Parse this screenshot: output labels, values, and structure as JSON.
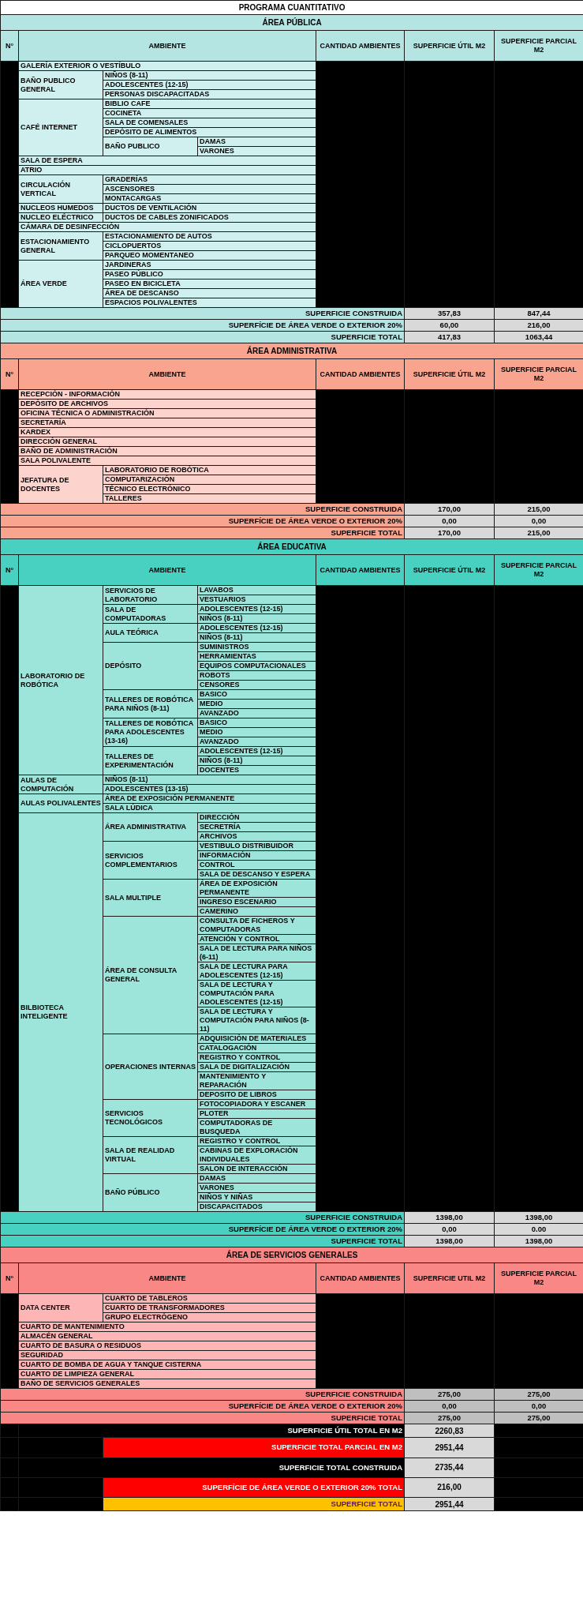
{
  "title": "PROGRAMA CUANTITATIVO",
  "sections": [
    {
      "title": "ÁREA  PÚBLICA",
      "kind": "publica",
      "columns": [
        "N°",
        "AMBIENTE",
        "CANTIDAD AMBIENTES",
        "SUPERFICIE ÚTIL M2",
        "SUPERFICIE PARCIAL M2"
      ],
      "rows": [
        {
          "label": "GALERÍA EXTERIOR O VESTÍBULO"
        },
        {
          "label": "BAÑO PUBLICO GENERAL",
          "children": [
            {
              "label": "NIÑOS (8-11)"
            },
            {
              "label": "ADOLESCENTES (12-15)"
            },
            {
              "label": "PERSONAS DISCAPACITADAS"
            }
          ]
        },
        {
          "label": "CAFÉ INTERNET",
          "children": [
            {
              "label": "BIBLIO CAFE"
            },
            {
              "label": "COCINETA"
            },
            {
              "label": "SALA DE COMENSALES"
            },
            {
              "label": "DEPÓSITO DE ALIMENTOS"
            },
            {
              "label": "BAÑO PUBLICO",
              "children": [
                {
                  "label": "DAMAS"
                },
                {
                  "label": "VARONES"
                }
              ]
            }
          ]
        },
        {
          "label": "SALA DE ESPERA"
        },
        {
          "label": "ATRIO"
        },
        {
          "label": "CIRCULACIÓN VERTICAL",
          "children": [
            {
              "label": "GRADERÍAS"
            },
            {
              "label": "ASCENSORES"
            },
            {
              "label": "MONTACARGAS"
            }
          ]
        },
        {
          "label": "NUCLEOS HUMEDOS",
          "children": [
            {
              "label": "DUCTOS DE VENTILACIÓN"
            }
          ]
        },
        {
          "label": "NUCLEO ELÉCTRICO",
          "children": [
            {
              "label": "DUCTOS DE CABLES ZONIFICADOS"
            }
          ]
        },
        {
          "label": "CÁMARA DE DESINFECCIÓN"
        },
        {
          "label": "ESTACIONAMIENTO GENERAL",
          "children": [
            {
              "label": "ESTACIONAMIENTO DE AUTOS"
            },
            {
              "label": "CICLOPUERTOS"
            },
            {
              "label": "PARQUEO MOMENTANEO"
            }
          ]
        },
        {
          "label": "ÁREA VERDE",
          "children": [
            {
              "label": "JARDINERAS"
            },
            {
              "label": "PASEO PÚBLICO"
            },
            {
              "label": "PASEO EN BICICLETA"
            },
            {
              "label": "ÁREA DE DESCANSO"
            },
            {
              "label": "ESPACIOS POLIVALENTES"
            }
          ]
        }
      ],
      "totals": [
        {
          "label": "SUPERFICIE CONSTRUIDA",
          "util": "357,83",
          "parcial": "847,44"
        },
        {
          "label": "SUPERFÍCIE DE ÁREA VERDE O EXTERIOR 20%",
          "util": "60,00",
          "parcial": "216,00"
        },
        {
          "label": "SUPERFICIE TOTAL",
          "util": "417,83",
          "parcial": "1063,44"
        }
      ]
    },
    {
      "title": "ÁREA ADMINISTRATIVA",
      "kind": "administrativa",
      "columns": [
        "N°",
        "AMBIENTE",
        "CANTIDAD AMBIENTES",
        "SUPERFICIE ÚTIL M2",
        "SUPERFICIE PARCIAL M2"
      ],
      "rows": [
        {
          "label": "RECEPCIÓN - INFORMACIÓN"
        },
        {
          "label": "DEPÓSITO DE ARCHIVOS"
        },
        {
          "label": "OFICINA TÉCNICA O ADMINISTRACIÓN"
        },
        {
          "label": "SECRETARÍA"
        },
        {
          "label": "KARDEX"
        },
        {
          "label": "DIRECCIÓN GENERAL"
        },
        {
          "label": "BAÑO DE ADMINISTRACIÓN"
        },
        {
          "label": "SALA POLIVALENTE"
        },
        {
          "label": "JEFATURA DE DOCENTES",
          "children": [
            {
              "label": "LABORATORIO DE ROBÓTICA"
            },
            {
              "label": "COMPUTARIZACIÓN"
            },
            {
              "label": "TÉCNICO ELECTRÓNICO"
            },
            {
              "label": "TALLERES"
            }
          ]
        }
      ],
      "totals": [
        {
          "label": "SUPERFICIE CONSTRUIDA",
          "util": "170,00",
          "parcial": "215,00"
        },
        {
          "label": "SUPERFÍCIE DE ÁREA VERDE O EXTERIOR 20%",
          "util": "0,00",
          "parcial": "0,00"
        },
        {
          "label": "SUPERFICIE TOTAL",
          "util": "170,00",
          "parcial": "215,00"
        }
      ]
    },
    {
      "title": "ÁREA EDUCATIVA",
      "kind": "educativa",
      "columns": [
        "N°",
        "AMBIENTE",
        "CANTIDAD AMBIENTES",
        "SUPERFICIE ÚTIL M2",
        "SUPERFICIE PARCIAL M2"
      ],
      "rows": [
        {
          "label": "LABORATORIO DE ROBÓTICA",
          "children": [
            {
              "label": "SERVICIOS DE LABORATORIO",
              "children": [
                {
                  "label": "LAVABOS"
                },
                {
                  "label": "VESTUARIOS"
                }
              ]
            },
            {
              "label": "SALA DE COMPUTADORAS",
              "children": [
                {
                  "label": "ADOLESCENTES (12-15)"
                },
                {
                  "label": "NIÑOS (8-11)"
                }
              ]
            },
            {
              "label": "AULA TEÓRICA",
              "children": [
                {
                  "label": "ADOLESCENTES (12-15)"
                },
                {
                  "label": "NIÑOS (8-11)"
                }
              ]
            },
            {
              "label": "DEPÓSITO",
              "children": [
                {
                  "label": "SUMINISTROS"
                },
                {
                  "label": "HERRAMIENTAS"
                },
                {
                  "label": "EQUIPOS COMPUTACIONALES"
                },
                {
                  "label": "ROBOTS"
                },
                {
                  "label": "CENSORES"
                }
              ]
            },
            {
              "label": "TALLERES DE ROBÓTICA PARA NIÑOS  (8-11)",
              "children": [
                {
                  "label": "BASICO"
                },
                {
                  "label": "MEDIO"
                },
                {
                  "label": "AVANZADO"
                }
              ]
            },
            {
              "label": "TALLERES DE ROBÓTICA PARA ADOLESCENTES (13-16)",
              "children": [
                {
                  "label": "BASICO"
                },
                {
                  "label": "MEDIO"
                },
                {
                  "label": "AVANZADO"
                }
              ]
            },
            {
              "label": "TALLERES DE EXPERIMENTACIÓN",
              "children": [
                {
                  "label": "ADOLESCENTES (12-15)"
                },
                {
                  "label": "NIÑOS (8-11)"
                },
                {
                  "label": "DOCENTES"
                }
              ]
            }
          ]
        },
        {
          "label": "AULAS DE COMPUTACIÓN",
          "children": [
            {
              "label": "NIÑOS (8-11)"
            },
            {
              "label": "ADOLESCENTES (13-15)"
            }
          ]
        },
        {
          "label": "AULAS POLIVALENTES",
          "children": [
            {
              "label": "ÁREA DE EXPOSICIÓN PERMANENTE"
            },
            {
              "label": "SALA LÚDICA"
            }
          ]
        },
        {
          "label": "BILBIOTECA INTELIGENTE",
          "children": [
            {
              "label": "ÁREA ADMINISTRATIVA",
              "children": [
                {
                  "label": "DIRECCIÓN"
                },
                {
                  "label": "SECRETRÍA"
                },
                {
                  "label": "ARCHIVOS"
                }
              ]
            },
            {
              "label": "SERVICIOS COMPLEMENTARIOS",
              "children": [
                {
                  "label": "VESTIBULO DISTRIBUIDOR"
                },
                {
                  "label": "INFORMACIÓN"
                },
                {
                  "label": "CONTROL"
                },
                {
                  "label": "SALA DE DESCANSO Y ESPERA"
                }
              ]
            },
            {
              "label": "SALA MULTIPLE",
              "children": [
                {
                  "label": "ÁREA DE EXPOSICIÓN PERMANENTE"
                },
                {
                  "label": "INGRESO ESCENARIO"
                },
                {
                  "label": "CAMERINO"
                }
              ]
            },
            {
              "label": "ÁREA DE CONSULTA GENERAL",
              "children": [
                {
                  "label": "CONSULTA DE FICHEROS Y COMPUTADORAS"
                },
                {
                  "label": "ATENCIÓN Y CONTROL"
                },
                {
                  "label": "SALA DE LECTURA PARA NIÑOS (6-11)"
                },
                {
                  "label": "SALA DE LECTURA PARA ADOLESCENTES (12-15)"
                },
                {
                  "label": "SALA DE LECTURA Y COMPUTACIÓN PARA ADOLESCENTES (12-15)"
                },
                {
                  "label": "SALA DE LECTURA Y COMPUTACIÓN PARA NIÑOS (8-11)"
                }
              ]
            },
            {
              "label": "OPERACIONES INTERNAS",
              "children": [
                {
                  "label": "ADQUISICIÓN DE MATERIALES"
                },
                {
                  "label": "CATALOGACIÓN"
                },
                {
                  "label": "REGISTRO Y CONTROL"
                },
                {
                  "label": "SALA DE DIGITALIZACIÓN"
                },
                {
                  "label": "MANTENIMIENTO Y REPARACIÓN"
                },
                {
                  "label": "DEPOSITO DE LIBROS"
                }
              ]
            },
            {
              "label": "SERVICIOS TECNOLÓGICOS",
              "children": [
                {
                  "label": "FOTOCOPIADORA Y ESCANER"
                },
                {
                  "label": "PLOTER"
                },
                {
                  "label": "COMPUTADORAS DE BUSQUEDA"
                }
              ]
            },
            {
              "label": "SALA DE REALIDAD VIRTUAL",
              "children": [
                {
                  "label": "REGISTRO Y CONTROL"
                },
                {
                  "label": "CABINAS DE EXPLORACIÓN INDIVIDUALES"
                },
                {
                  "label": "SALON DE INTERACCIÓN"
                }
              ]
            },
            {
              "label": "BAÑO PÚBLICO",
              "children": [
                {
                  "label": "DAMAS"
                },
                {
                  "label": "VARONES"
                },
                {
                  "label": "NIÑOS Y NIÑAS"
                },
                {
                  "label": "DISCAPACITADOS"
                }
              ]
            }
          ]
        }
      ],
      "totals": [
        {
          "label": "SUPERFICIE CONSTRUIDA",
          "util": "1398,00",
          "parcial": "1398,00"
        },
        {
          "label": "SUPERFÍCIE DE ÁREA VERDE O EXTERIOR 20%",
          "util": "0,00",
          "parcial": "0.00"
        },
        {
          "label": "SUPERFICIE TOTAL",
          "util": "1398,00",
          "parcial": "1398,00"
        }
      ]
    },
    {
      "title": "ÁREA DE SERVICIOS GENERALES",
      "kind": "servicios",
      "columns": [
        "N°",
        "AMBIENTE",
        "CANTIDAD AMBIENTES",
        "SUPERFICIE UTIL M2",
        "SUPERFICIE PARCIAL M2"
      ],
      "rows": [
        {
          "label": "DATA CENTER",
          "children": [
            {
              "label": "CUARTO DE TABLEROS"
            },
            {
              "label": "CUARTO DE TRANSFORMADORES"
            },
            {
              "label": "GRUPO ELECTRÓGENO"
            }
          ]
        },
        {
          "label": "CUARTO DE MANTENIMIENTO"
        },
        {
          "label": "ALMACÉN GENERAL"
        },
        {
          "label": "CUARTO DE BASURA O RESIDUOS"
        },
        {
          "label": "SEGURIDAD"
        },
        {
          "label": "CUARTO DE BOMBA DE AGUA Y TANQUE CISTERNA"
        },
        {
          "label": "CUARTO DE LIMPIEZA GENERAL"
        },
        {
          "label": "BAÑO DE SERVICIOS GENERALES"
        }
      ],
      "totals": [
        {
          "label": "SUPERFICIE CONSTRUIDA",
          "util": "275,00",
          "parcial": "275,00"
        },
        {
          "label": "SUPERFÍCIE DE ÁREA VERDE O EXTERIOR 20%",
          "util": "0,00",
          "parcial": "0,00"
        },
        {
          "label": "SUPERFICIE TOTAL",
          "util": "275,00",
          "parcial": "275,00"
        }
      ]
    }
  ],
  "summary": [
    {
      "label": "SUPERFICIE ÚTIL TOTAL EN M2",
      "value": "2260,83",
      "kind": "black"
    },
    {
      "label": "SUPERFICIE TOTAL PARCIAL EN M2",
      "value": "2951,44",
      "kind": "red"
    },
    {
      "label": "SUPERFICIE TOTAL CONSTRUIDA",
      "value": "2735,44",
      "kind": "black"
    },
    {
      "label": "SUPERFÍCIE DE ÁREA VERDE O EXTERIOR 20% TOTAL",
      "value": "216,00",
      "kind": "red"
    },
    {
      "label": "SUPERFICIE TOTAL",
      "value": "2951,44",
      "kind": "yellow"
    }
  ]
}
